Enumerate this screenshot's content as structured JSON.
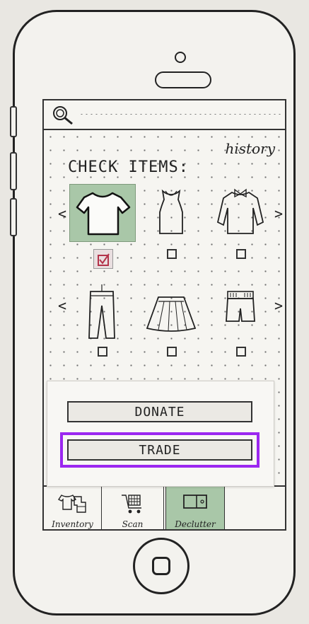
{
  "search": {
    "placeholder": ""
  },
  "header": {
    "history_label": "history"
  },
  "main": {
    "title": "CHECK ITEMS:",
    "prev_arrow": "<",
    "next_arrow": ">",
    "items": [
      {
        "name": "t-shirt",
        "checked": true
      },
      {
        "name": "tank-top",
        "checked": false
      },
      {
        "name": "long-sleeve-shirt",
        "checked": false
      },
      {
        "name": "pants",
        "checked": false
      },
      {
        "name": "skirt",
        "checked": false
      },
      {
        "name": "shorts",
        "checked": false
      }
    ]
  },
  "actions": {
    "donate_label": "DONATE",
    "trade_label": "TRADE"
  },
  "tabs": [
    {
      "label": "Inventory",
      "icon": "clothes-icon",
      "active": false
    },
    {
      "label": "Scan",
      "icon": "cart-icon",
      "active": false
    },
    {
      "label": "Declutter",
      "icon": "box-icon",
      "active": true
    }
  ],
  "colors": {
    "selected": "#a9c7a8",
    "highlight": "#9b27f0",
    "check": "#b3334a"
  }
}
